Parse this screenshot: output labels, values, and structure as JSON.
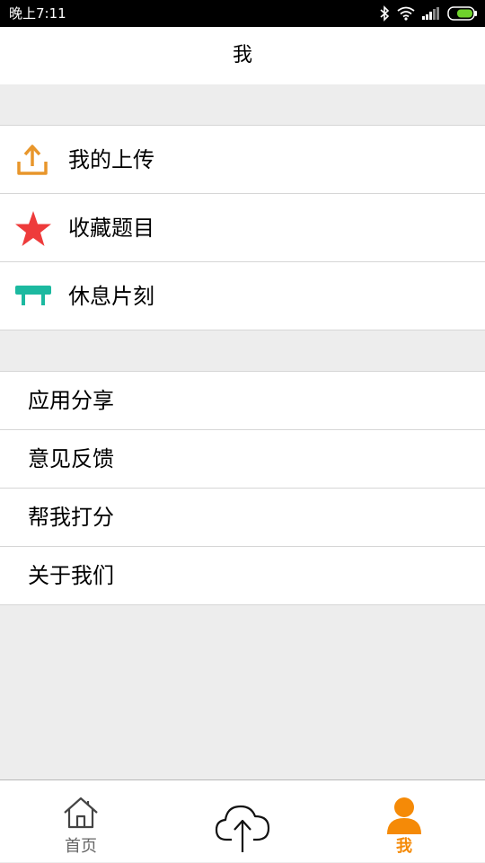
{
  "status_bar": {
    "time": "晚上7:11",
    "icons": [
      "bluetooth-icon",
      "wifi-icon",
      "signal-icon",
      "battery-icon"
    ]
  },
  "header": {
    "title": "我"
  },
  "menu_main": [
    {
      "label": "我的上传",
      "icon": "upload-icon",
      "color": "#e8962b"
    },
    {
      "label": "收藏题目",
      "icon": "star-icon",
      "color": "#ee3b3b"
    },
    {
      "label": "休息片刻",
      "icon": "bench-icon",
      "color": "#1cb9a0"
    }
  ],
  "menu_secondary": [
    {
      "label": "应用分享"
    },
    {
      "label": "意见反馈"
    },
    {
      "label": "帮我打分"
    },
    {
      "label": "关于我们"
    }
  ],
  "tab_bar": {
    "home_label": "首页",
    "upload_icon": "cloud-upload-icon",
    "me_label": "我",
    "active_color": "#f58a07",
    "inactive_color": "#666666"
  }
}
